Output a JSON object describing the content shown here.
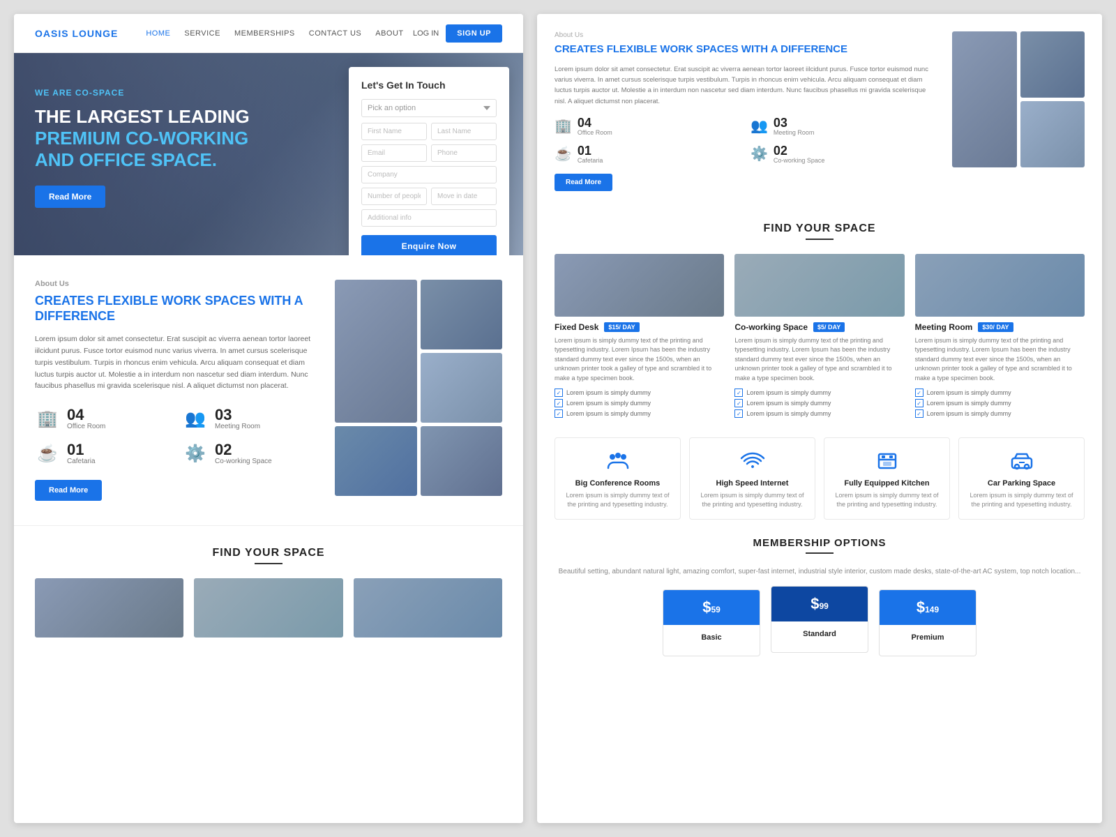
{
  "brand": {
    "logo": "OASIS LOUNGE"
  },
  "nav": {
    "links": [
      {
        "label": "HOME",
        "active": true
      },
      {
        "label": "SERVICE",
        "active": false
      },
      {
        "label": "MEMBERSHIPS",
        "active": false
      },
      {
        "label": "CONTACT US",
        "active": false
      },
      {
        "label": "ABOUT",
        "active": false
      }
    ],
    "login": "LOG IN",
    "signup": "SIGN UP"
  },
  "hero": {
    "subtitle": "WE ARE CO-SPACE",
    "title_line1": "THE LARGEST LEADING",
    "title_line2": "PREMIUM CO-WORKING",
    "title_line3": "AND OFFICE SPACE.",
    "cta": "Read More"
  },
  "contact_form": {
    "title": "Let's Get In Touch",
    "select_placeholder": "Pick an option",
    "first_name": "First Name",
    "last_name": "Last Name",
    "email": "Email",
    "phone": "Phone",
    "company": "Company",
    "people": "Number of people",
    "move_in": "Move in date",
    "additional": "Additional info",
    "submit": "Enquire Now"
  },
  "about": {
    "label": "About Us",
    "title": "CREATES FLEXIBLE WORK SPACES WITH A DIFFERENCE",
    "body": "Lorem ipsum dolor sit amet consectetur. Erat suscipit ac viverra aenean tortor laoreet iilcidunt purus. Fusce tortor euismod nunc varius viverra. In amet cursus scelerisque turpis vestibulum. Turpis in rhoncus enim vehicula. Arcu aliquam consequat et diam luctus turpis auctor ut. Molestie a in interdum non nascetur sed diam interdum. Nunc faucibus phasellus mi gravida scelerisque nisl. A aliquet dictumst non placerat.",
    "stats": [
      {
        "icon": "🏢",
        "number": "04",
        "label": "Office Room"
      },
      {
        "icon": "👥",
        "number": "03",
        "label": "Meeting Room"
      },
      {
        "icon": "☕",
        "number": "01",
        "label": "Cafetaria"
      },
      {
        "icon": "⚙️",
        "number": "02",
        "label": "Co-working Space"
      }
    ],
    "cta": "Read More"
  },
  "find_space": {
    "title": "FIND YOUR SPACE",
    "cards": [
      {
        "name": "Fixed Desk",
        "price": "$15/ DAY",
        "desc": "Lorem ipsum is simply dummy text of the printing and typesetting industry. Lorem Ipsum has been the industry standard dummy text ever since the 1500s, when an unknown printer took a galley of type and scrambled it to make a type specimen book.",
        "features": [
          "Lorem ipsum is simply dummy",
          "Lorem ipsum is simply dummy",
          "Lorem ipsum is simply dummy"
        ]
      },
      {
        "name": "Co-working Space",
        "price": "$5/ DAY",
        "desc": "Lorem ipsum is simply dummy text of the printing and typesetting industry. Lorem Ipsum has been the industry standard dummy text ever since the 1500s, when an unknown printer took a galley of type and scrambled it to make a type specimen book.",
        "features": [
          "Lorem ipsum is simply dummy",
          "Lorem ipsum is simply dummy",
          "Lorem ipsum is simply dummy"
        ]
      },
      {
        "name": "Meeting Room",
        "price": "$30/ DAY",
        "desc": "Lorem ipsum is simply dummy text of the printing and typesetting industry. Lorem Ipsum has been the industry standard dummy text ever since the 1500s, when an unknown printer took a galley of type and scrambled it to make a type specimen book.",
        "features": [
          "Lorem ipsum is simply dummy",
          "Lorem ipsum is simply dummy",
          "Lorem ipsum is simply dummy"
        ]
      }
    ]
  },
  "amenities": {
    "items": [
      {
        "icon": "👥",
        "name": "Big Conference Rooms",
        "desc": "Lorem ipsum is simply dummy text of the printing and typesetting industry."
      },
      {
        "icon": "📶",
        "name": "High Speed Internet",
        "desc": "Lorem ipsum is simply dummy text of the printing and typesetting industry."
      },
      {
        "icon": "🍳",
        "name": "Fully Equipped Kitchen",
        "desc": "Lorem ipsum is simply dummy text of the printing and typesetting industry."
      },
      {
        "icon": "🚗",
        "name": "Car Parking Space",
        "desc": "Lorem ipsum is simply dummy text of the printing and typesetting industry."
      }
    ]
  },
  "membership": {
    "title": "MEMBERSHIP OPTIONS",
    "subtitle": "Beautiful setting, abundant natural light, amazing comfort, super-fast internet, industrial style interior, custom made desks, state-of-the-art AC system, top notch location...",
    "cards": [
      {
        "price": "59",
        "currency": "$",
        "type": "Basic"
      },
      {
        "price": "99",
        "currency": "$",
        "type": "Standard"
      },
      {
        "price": "149",
        "currency": "$",
        "type": "Premium"
      }
    ]
  }
}
